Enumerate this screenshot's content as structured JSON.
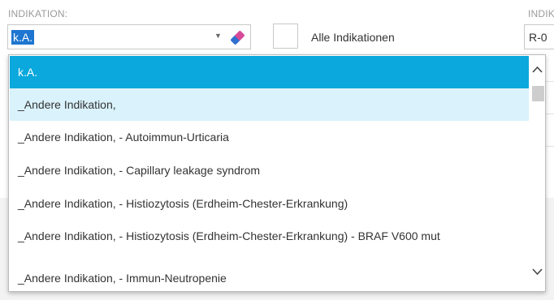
{
  "form": {
    "indikation_label": "INDIKATION:",
    "right_label": "INDIK",
    "selected_value": "k.A.",
    "alle_indikationen": "Alle Indikationen",
    "right_value": "R-0"
  },
  "dropdown": {
    "items": [
      {
        "label": "k.A.",
        "state": "selected"
      },
      {
        "label": "_Andere Indikation,",
        "state": "hover"
      },
      {
        "label": "_Andere Indikation, - Autoimmun-Urticaria",
        "state": "normal"
      },
      {
        "label": "_Andere Indikation, - Capillary leakage syndrom",
        "state": "normal"
      },
      {
        "label": "_Andere Indikation, - Histiozytosis (Erdheim-Chester-Erkrankung)",
        "state": "normal"
      },
      {
        "label": "_Andere Indikation, - Histiozytosis (Erdheim-Chester-Erkrankung) - BRAF V600 mut",
        "state": "normal"
      },
      {
        "label": "_Andere Indikation, - Immun-Neutropenie",
        "state": "normal"
      }
    ]
  },
  "icons": {
    "combo_caret": "chevron-down-icon",
    "clear": "eraser-icon",
    "scroll_up": "chevron-up-icon",
    "scroll_down": "chevron-down-icon"
  },
  "colors": {
    "selected_item": "#0aa8dc",
    "hover_item": "#d9f2fb",
    "text_selection": "#1e76d0"
  }
}
